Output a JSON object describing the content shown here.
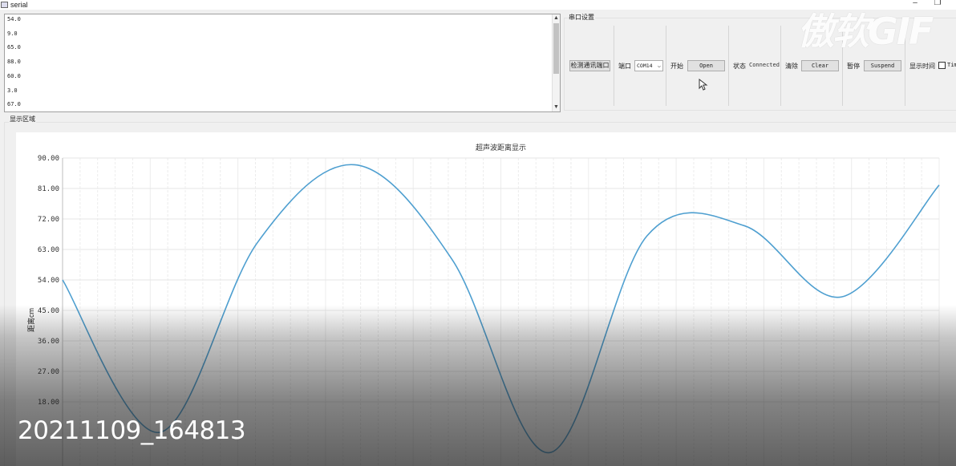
{
  "window": {
    "title": "serial",
    "minimize": "–",
    "restore": "❐"
  },
  "received_lines": [
    "54.0",
    "9.0",
    "65.0",
    "88.0",
    "60.0",
    "3.0",
    "67.0"
  ],
  "settings": {
    "group_title": "串口设置",
    "detect_button": "检测通讯端口",
    "port_label": "端口",
    "port_value": "COM14",
    "start_label": "开始",
    "open_button": "Open",
    "status_label": "状态",
    "status_value": "Connected",
    "clear_label": "清除",
    "clear_button": "Clear",
    "pause_label": "暂停",
    "suspend_button": "Suspend",
    "time_label": "显示时间",
    "time_checkbox_label": "Tim"
  },
  "display": {
    "group_title": "显示区域"
  },
  "chart_data": {
    "type": "line",
    "title": "超声波距离显示",
    "ylabel": "距离cm",
    "xlabel": "",
    "ylim": [
      0,
      90
    ],
    "y_ticks": [
      "90.00",
      "81.00",
      "72.00",
      "63.00",
      "54.00",
      "45.00",
      "36.00",
      "27.00",
      "18.00"
    ],
    "grid": true,
    "series": [
      {
        "color": "#4e9fd0",
        "points": [
          [
            0,
            54
          ],
          [
            1,
            9
          ],
          [
            2,
            65
          ],
          [
            3,
            88
          ],
          [
            4,
            60
          ],
          [
            5,
            3
          ],
          [
            6,
            67
          ],
          [
            7,
            70
          ],
          [
            8,
            49
          ],
          [
            9,
            82
          ]
        ]
      }
    ]
  },
  "overlay": {
    "watermark": "傲软GIF",
    "caption": "20211109_164813"
  }
}
